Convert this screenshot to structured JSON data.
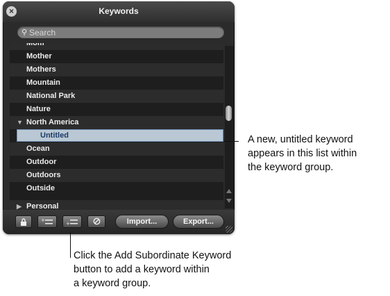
{
  "window": {
    "title": "Keywords"
  },
  "search": {
    "placeholder": "Search"
  },
  "keywords": [
    {
      "label": "Mom"
    },
    {
      "label": "Mother"
    },
    {
      "label": "Mothers"
    },
    {
      "label": "Mountain"
    },
    {
      "label": "National Park"
    },
    {
      "label": "Nature"
    },
    {
      "label": "North America",
      "expanded": true
    },
    {
      "label": "Untitled",
      "child": true,
      "selected": true
    },
    {
      "label": "Ocean"
    },
    {
      "label": "Outdoor"
    },
    {
      "label": "Outdoors"
    },
    {
      "label": "Outside"
    },
    {
      "label": "Personal",
      "collapsed": true
    }
  ],
  "toolbar": {
    "lock_icon": "lock-icon",
    "add_keyword_icon": "add-keyword-icon",
    "add_subordinate_icon": "add-subordinate-keyword-icon",
    "remove_icon": "remove-icon",
    "import_label": "Import...",
    "export_label": "Export..."
  },
  "annotations": {
    "right_lines": [
      "A new, untitled keyword",
      "appears in this list within",
      "the keyword group."
    ],
    "bottom_lines": [
      "Click the Add Subordinate Keyword",
      "button to add a keyword within",
      "a keyword group."
    ]
  },
  "colors": {
    "panel": "#2b2b2b",
    "row_dark": "#1e1e1e",
    "row_light": "#2c2c2c",
    "selection": "#b9c8d4",
    "selection_border": "#6f8db3"
  }
}
